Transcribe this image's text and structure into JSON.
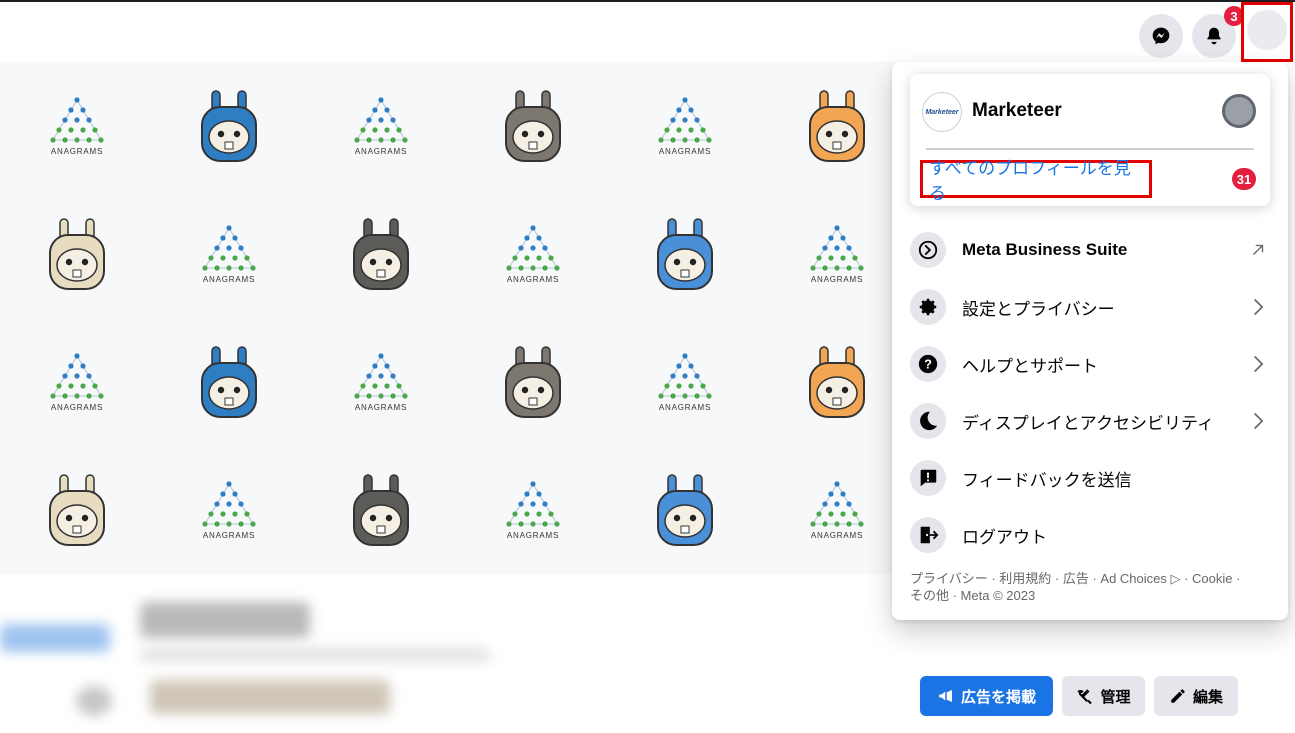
{
  "topbar": {
    "messenger_icon": "messenger-icon",
    "notifications_icon": "bell-icon",
    "notification_count": "3"
  },
  "cover": {
    "logo_text": "ANAGRAMS",
    "pattern_rows": 4,
    "pattern_cols": 6
  },
  "account_menu": {
    "profile_name": "Marketeer",
    "profile_logo_text": "Marketeer",
    "see_all_profiles": "すべてのプロフィールを見る",
    "profiles_badge": "31",
    "items": [
      {
        "label": "Meta Business Suite",
        "icon": "business-suite-icon",
        "trail": "external-arrow"
      },
      {
        "label": "設定とプライバシー",
        "icon": "gear-icon",
        "trail": "chevron-right"
      },
      {
        "label": "ヘルプとサポート",
        "icon": "help-icon",
        "trail": "chevron-right"
      },
      {
        "label": "ディスプレイとアクセシビリティ",
        "icon": "moon-icon",
        "trail": "chevron-right"
      },
      {
        "label": "フィードバックを送信",
        "icon": "feedback-icon",
        "trail": ""
      },
      {
        "label": "ログアウト",
        "icon": "logout-icon",
        "trail": ""
      }
    ],
    "footer_line1": "プライバシー · 利用規約 · 広告 · Ad Choices ▷ · Cookie ·",
    "footer_line2": "その他 · Meta © 2023"
  },
  "page_actions": {
    "advertise": "広告を掲載",
    "manage": "管理",
    "edit": "編集"
  },
  "colors": {
    "accent": "#1b74e4",
    "badge": "#e41e3f",
    "highlight": "#e50000"
  }
}
